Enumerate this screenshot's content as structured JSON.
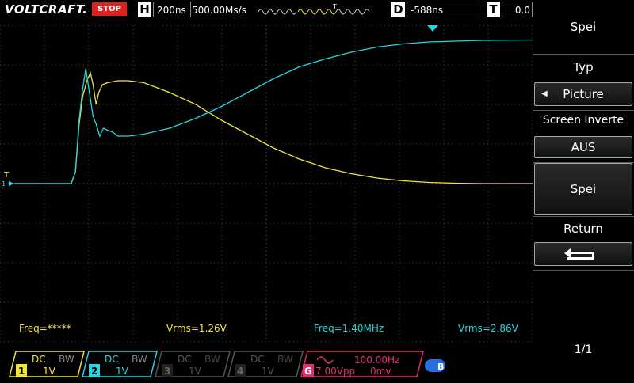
{
  "header": {
    "brand": "VOLTCRAFT.",
    "run_state": "STOP",
    "timebase_label": "H",
    "timebase_value": "200ns",
    "sample_rate": "500.00Ms/s",
    "trigger_marker": "T",
    "delay_label": "D",
    "delay_value": "-588ns",
    "trigger_label": "T",
    "trigger_value": "0.0"
  },
  "scope": {
    "grid_color": "#5a5a5a",
    "ch1_color": "#f0e53a",
    "ch2_color": "#25d6e0",
    "ch1_trace": [
      [
        0,
        0
      ],
      [
        0.1,
        0
      ],
      [
        0.11,
        0
      ],
      [
        0.118,
        -0.3
      ],
      [
        0.125,
        -1.5
      ],
      [
        0.132,
        -2.2
      ],
      [
        0.14,
        -2.6
      ],
      [
        0.147,
        -2.8
      ],
      [
        0.152,
        -2.5
      ],
      [
        0.158,
        -2.0
      ],
      [
        0.163,
        -2.3
      ],
      [
        0.17,
        -2.5
      ],
      [
        0.18,
        -2.55
      ],
      [
        0.2,
        -2.6
      ],
      [
        0.22,
        -2.6
      ],
      [
        0.25,
        -2.55
      ],
      [
        0.3,
        -2.3
      ],
      [
        0.35,
        -2.0
      ],
      [
        0.4,
        -1.6
      ],
      [
        0.45,
        -1.25
      ],
      [
        0.5,
        -0.9
      ],
      [
        0.55,
        -0.62
      ],
      [
        0.6,
        -0.4
      ],
      [
        0.65,
        -0.25
      ],
      [
        0.7,
        -0.14
      ],
      [
        0.75,
        -0.07
      ],
      [
        0.8,
        -0.03
      ],
      [
        0.85,
        -0.01
      ],
      [
        0.9,
        0
      ],
      [
        1.0,
        0
      ]
    ],
    "ch2_trace": [
      [
        0,
        0
      ],
      [
        0.1,
        0
      ],
      [
        0.11,
        0
      ],
      [
        0.118,
        -0.3
      ],
      [
        0.125,
        -1.6
      ],
      [
        0.132,
        -2.4
      ],
      [
        0.138,
        -2.9
      ],
      [
        0.145,
        -2.3
      ],
      [
        0.152,
        -1.7
      ],
      [
        0.158,
        -1.5
      ],
      [
        0.165,
        -1.2
      ],
      [
        0.172,
        -1.4
      ],
      [
        0.18,
        -1.35
      ],
      [
        0.19,
        -1.3
      ],
      [
        0.2,
        -1.2
      ],
      [
        0.22,
        -1.2
      ],
      [
        0.25,
        -1.25
      ],
      [
        0.3,
        -1.4
      ],
      [
        0.35,
        -1.65
      ],
      [
        0.4,
        -1.95
      ],
      [
        0.45,
        -2.3
      ],
      [
        0.5,
        -2.65
      ],
      [
        0.55,
        -2.95
      ],
      [
        0.6,
        -3.15
      ],
      [
        0.65,
        -3.32
      ],
      [
        0.7,
        -3.45
      ],
      [
        0.75,
        -3.53
      ],
      [
        0.8,
        -3.58
      ],
      [
        0.85,
        -3.6
      ],
      [
        0.9,
        -3.62
      ],
      [
        1.0,
        -3.63
      ]
    ],
    "meas_ch1_freq": "Freq=*****",
    "meas_ch1_vrms": "Vrms=1.26V",
    "meas_ch2_freq": "Freq=1.40MHz",
    "meas_ch2_vrms": "Vrms=2.86V",
    "ch_marker_label": "T",
    "ch_marker_num": "1"
  },
  "panel": {
    "title": "Spei",
    "typ_label": "Typ",
    "typ_value": "Picture",
    "screen_invert_label": "Screen Inverte",
    "screen_invert_value": "AUS",
    "save_label": "Spei",
    "return_label": "Return",
    "page": "1/1"
  },
  "channels": [
    {
      "num": "1",
      "coupling": "DC",
      "bw": "BW",
      "scale": "1V",
      "color": "#f0e53a"
    },
    {
      "num": "2",
      "coupling": "DC",
      "bw": "BW",
      "scale": "1V",
      "color": "#25d6e0"
    },
    {
      "num": "3",
      "coupling": "DC",
      "bw": "BW",
      "scale": "1V",
      "color": "#555555"
    },
    {
      "num": "4",
      "coupling": "DC",
      "bw": "BW",
      "scale": "1V",
      "color": "#555555"
    }
  ],
  "generator": {
    "label": "G",
    "freq": "100.00Hz",
    "amp": "7.00Vpp",
    "offset": "0mv",
    "color": "#e03071"
  },
  "bluetooth_label": "B"
}
